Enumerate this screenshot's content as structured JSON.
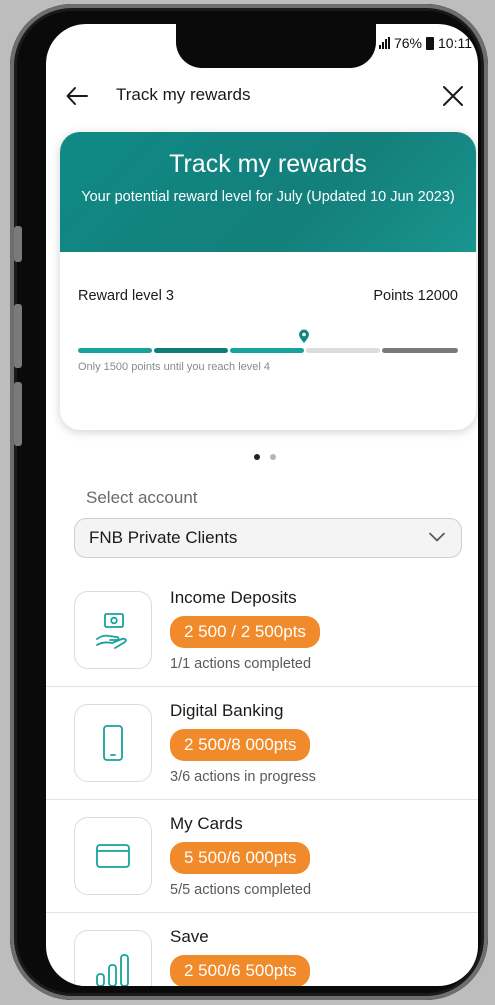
{
  "status_bar": {
    "battery": "76%",
    "time": "10:11"
  },
  "header": {
    "title": "Track my rewards"
  },
  "card": {
    "title": "Track my rewards",
    "subtitle": "Your potential reward level for July (Updated 10 Jun 2023)",
    "level": "Reward level 3",
    "points": "Points 12000",
    "hint": "Only 1500 points until you reach level 4",
    "progress_fraction": 0.6
  },
  "colors": {
    "brand_teal": "#128884",
    "accent_orange": "#f08a2a"
  },
  "select": {
    "label": "Select account",
    "value": "FNB Private Clients"
  },
  "rewards": [
    {
      "icon": "money-hand-icon",
      "title": "Income Deposits",
      "points": "2 500 / 2 500pts",
      "note": "1/1 actions completed"
    },
    {
      "icon": "phone-icon",
      "title": "Digital Banking",
      "points": "2 500/8 000pts",
      "note": "3/6 actions  in progress"
    },
    {
      "icon": "card-icon",
      "title": "My Cards",
      "points": "5 500/6 000pts",
      "note": "5/5 actions completed"
    },
    {
      "icon": "bar-chart-icon",
      "title": "Save",
      "points": "2 500/6 500pts",
      "note": ""
    }
  ]
}
